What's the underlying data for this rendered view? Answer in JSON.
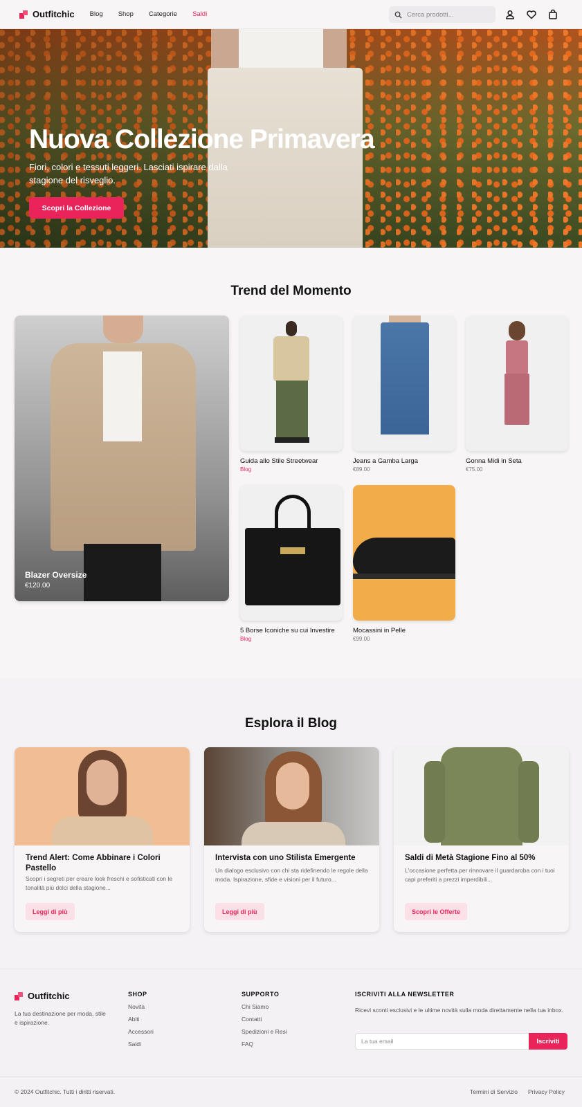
{
  "brand": {
    "name": "Outfitchic",
    "accent": "#e8245a"
  },
  "nav": {
    "links": [
      "Blog",
      "Shop",
      "Categorie",
      "Saldi"
    ],
    "search_placeholder": "Cerca prodotti...",
    "icons": [
      "user-icon",
      "heart-icon",
      "shopping-bag-icon"
    ]
  },
  "hero": {
    "title": "Nuova Collezione Primavera",
    "subtitle": "Fiori, colori e tessuti leggeri. Lasciati ispirare dalla stagione del risveglio.",
    "cta": "Scopri la Collezione"
  },
  "trends": {
    "title": "Trend del Momento",
    "featured": {
      "name": "Blazer Oversize",
      "price": "€120.00"
    },
    "items": [
      {
        "name": "Guida allo Stile Streetwear",
        "meta": "Blog"
      },
      {
        "name": "Jeans a Gamba Larga",
        "meta": "€89.00"
      },
      {
        "name": "Gonna Midi in Seta",
        "meta": "€75.00"
      },
      {
        "name": "5 Borse Iconiche su cui Investire",
        "meta": "Blog"
      },
      {
        "name": "Mocassini in Pelle",
        "meta": "€99.00"
      }
    ]
  },
  "blog": {
    "title": "Esplora il Blog",
    "posts": [
      {
        "title": "Trend Alert: Come Abbinare i Colori Pastello",
        "excerpt": "Scopri i segreti per creare look freschi e sofisticati con le tonalità più dolci della stagione...",
        "cta": "Leggi di più"
      },
      {
        "title": "Intervista con uno Stilista Emergente",
        "excerpt": "Un dialogo esclusivo con chi sta ridefinendo le regole della moda. Ispirazione, sfide e visioni per il futuro...",
        "cta": "Leggi di più"
      },
      {
        "title": "Saldi di Metà Stagione Fino al 50%",
        "excerpt": "L'occasione perfetta per rinnovare il guardaroba con i tuoi capi preferiti a prezzi imperdibili...",
        "cta": "Scopri le Offerte"
      }
    ]
  },
  "footer": {
    "tagline": "La tua destinazione per moda, stile e ispirazione.",
    "shop": {
      "heading": "SHOP",
      "links": [
        "Novità",
        "Abiti",
        "Accessori",
        "Saldi"
      ]
    },
    "support": {
      "heading": "SUPPORTO",
      "links": [
        "Chi Siamo",
        "Contatti",
        "Spedizioni e Resi",
        "FAQ"
      ]
    },
    "newsletter": {
      "heading": "ISCRIVITI ALLA NEWSLETTER",
      "text": "Ricevi sconti esclusivi e le ultime novità sulla moda direttamente nella tua inbox.",
      "placeholder": "La tua email",
      "button": "Iscriviti"
    },
    "copyright": "© 2024 Outfitchic. Tutti i diritti riservati.",
    "legal": [
      "Termini di Servizio",
      "Privacy Policy"
    ]
  }
}
